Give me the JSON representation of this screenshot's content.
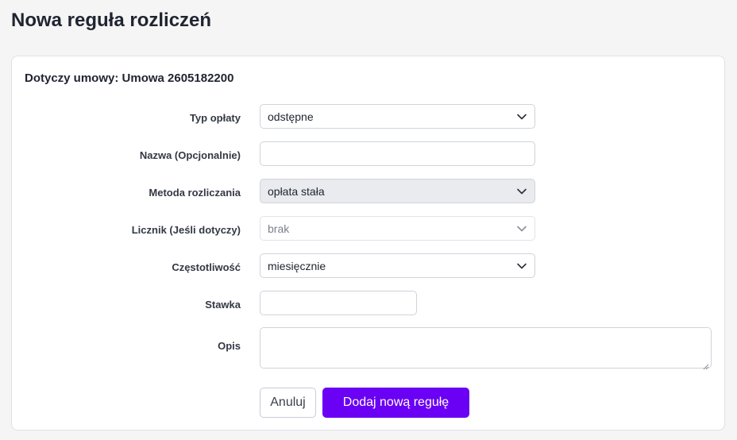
{
  "page": {
    "title": "Nowa reguła rozliczeń"
  },
  "card": {
    "title": "Dotyczy umowy: Umowa 2605182200"
  },
  "form": {
    "fee_type": {
      "label": "Typ opłaty",
      "value": "odstępne"
    },
    "name": {
      "label": "Nazwa (Opcjonalnie)",
      "value": ""
    },
    "billing_method": {
      "label": "Metoda rozliczania",
      "value": "opłata stała"
    },
    "meter": {
      "label": "Licznik (Jeśli dotyczy)",
      "value": "brak"
    },
    "frequency": {
      "label": "Częstotliwość",
      "value": "miesięcznie"
    },
    "rate": {
      "label": "Stawka",
      "value": ""
    },
    "description": {
      "label": "Opis",
      "value": ""
    }
  },
  "actions": {
    "cancel_label": "Anuluj",
    "submit_label": "Dodaj nową regułę"
  },
  "colors": {
    "primary": "#6a00f4",
    "background": "#f5f5f6",
    "readonly_bg": "#e9ebef"
  },
  "icons": {
    "select_arrow": "chevron-down-icon"
  }
}
